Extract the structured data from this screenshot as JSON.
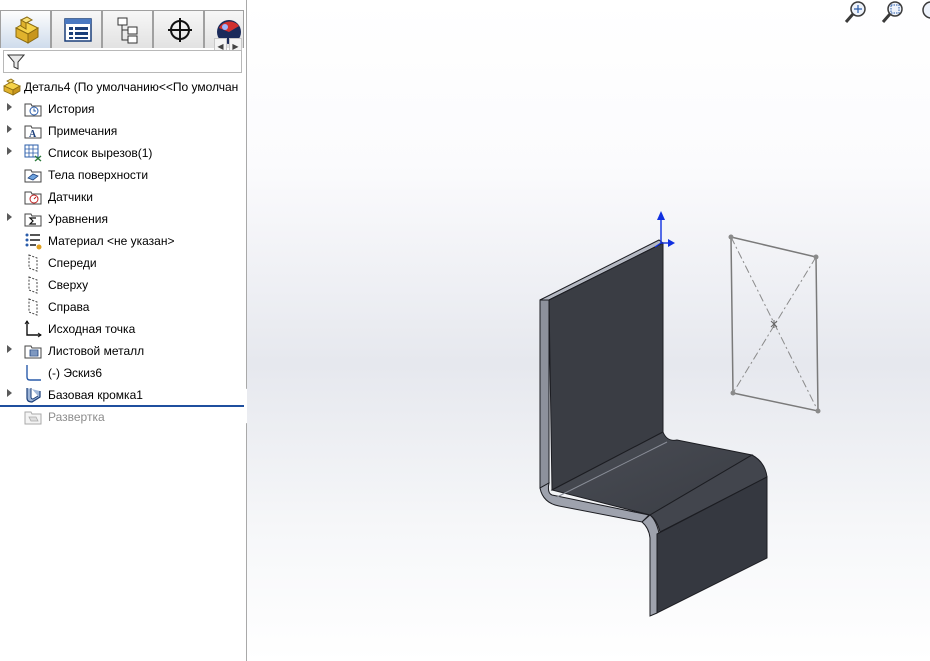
{
  "feature_tree": {
    "root": "Деталь4  (По умолчанию<<По умолчан",
    "items": [
      {
        "label": "История",
        "icon": "history-folder-icon",
        "expandable": true
      },
      {
        "label": "Примечания",
        "icon": "annotations-icon",
        "expandable": true
      },
      {
        "label": "Список вырезов(1)",
        "icon": "cut-list-icon",
        "expandable": true
      },
      {
        "label": "Тела поверхности",
        "icon": "surface-bodies-icon",
        "expandable": false
      },
      {
        "label": "Датчики",
        "icon": "sensors-icon",
        "expandable": false
      },
      {
        "label": "Уравнения",
        "icon": "equations-icon",
        "expandable": true
      },
      {
        "label": "Материал <не указан>",
        "icon": "material-icon",
        "expandable": false
      },
      {
        "label": "Спереди",
        "icon": "plane-icon",
        "expandable": false
      },
      {
        "label": "Сверху",
        "icon": "plane-icon",
        "expandable": false
      },
      {
        "label": "Справа",
        "icon": "plane-icon",
        "expandable": false
      },
      {
        "label": "Исходная точка",
        "icon": "origin-icon",
        "expandable": false
      },
      {
        "label": "Листовой металл",
        "icon": "sheet-metal-icon",
        "expandable": true
      },
      {
        "label": "(-) Эскиз6",
        "icon": "sketch-icon",
        "expandable": false
      },
      {
        "label": "Базовая кромка1",
        "icon": "base-flange-icon",
        "expandable": true
      },
      {
        "label": "Развертка",
        "icon": "flat-pattern-icon",
        "expandable": false,
        "suppressed": true
      }
    ]
  },
  "colors": {
    "model_face": "#3a3d44",
    "model_edge": "#1c1d22",
    "rollback_bar": "#1f4f9e",
    "triad_blue": "#1030e0"
  }
}
